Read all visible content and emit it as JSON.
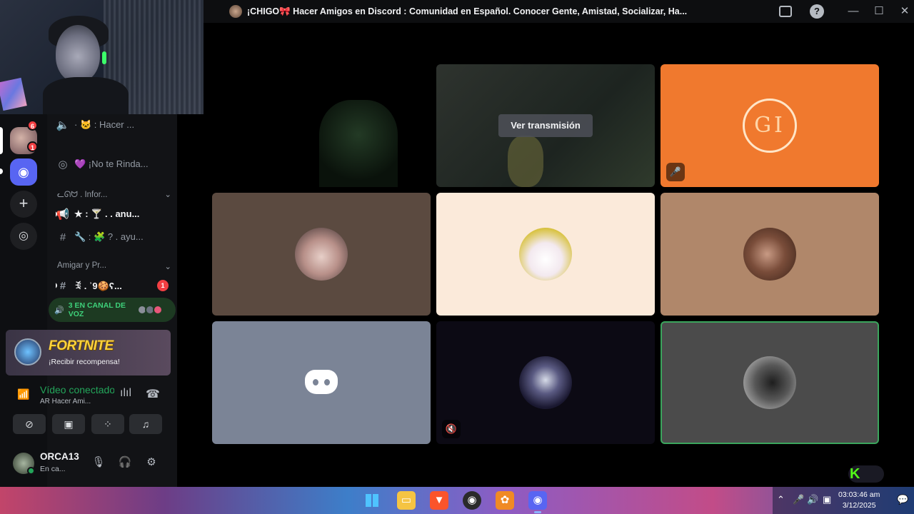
{
  "topbar": {
    "channel_title": "¡CHIGO🎀 Hacer Amigos en Discord : Comunidad en Español. Conocer Gente, Amistad, Socializar, Ha..."
  },
  "rail": {
    "server_badge": "6",
    "server2_badge": "1"
  },
  "sidebar": {
    "channels": [
      {
        "label": "· 🐱 : Hacer ..."
      },
      {
        "label": "💜 ¡No te Rinda..."
      },
      {
        "label": "ᓚᘏᗢ . Infor..."
      },
      {
        "label": "★ : 🍸 .  .  anu..."
      },
      {
        "label": "🔧 : 🧩 ?  .  ayu..."
      },
      {
        "label": "Amigar y Pr..."
      },
      {
        "label": "ꉂ . ʾ9🍪ʕ..."
      }
    ],
    "channel_badge": "1",
    "voice_pill_label": "3 EN CANAL DE VOZ"
  },
  "promo": {
    "game": "FORTNITE",
    "reward": "¡Recibir recompensa!"
  },
  "voice": {
    "status": "Vídeo conectado",
    "sub": "AR  Hacer Ami..."
  },
  "user": {
    "name": "ORCA13",
    "sub": "En ca..."
  },
  "grid": {
    "watch_stream": "Ver transmisión",
    "gi_initials": "GI"
  },
  "taskbar": {
    "time": "03:03:46 am",
    "date": "3/12/2025"
  },
  "colors": {
    "accent_green": "#23a55a",
    "orange_tile": "#f0792e",
    "discord_blurple": "#5865f2"
  }
}
